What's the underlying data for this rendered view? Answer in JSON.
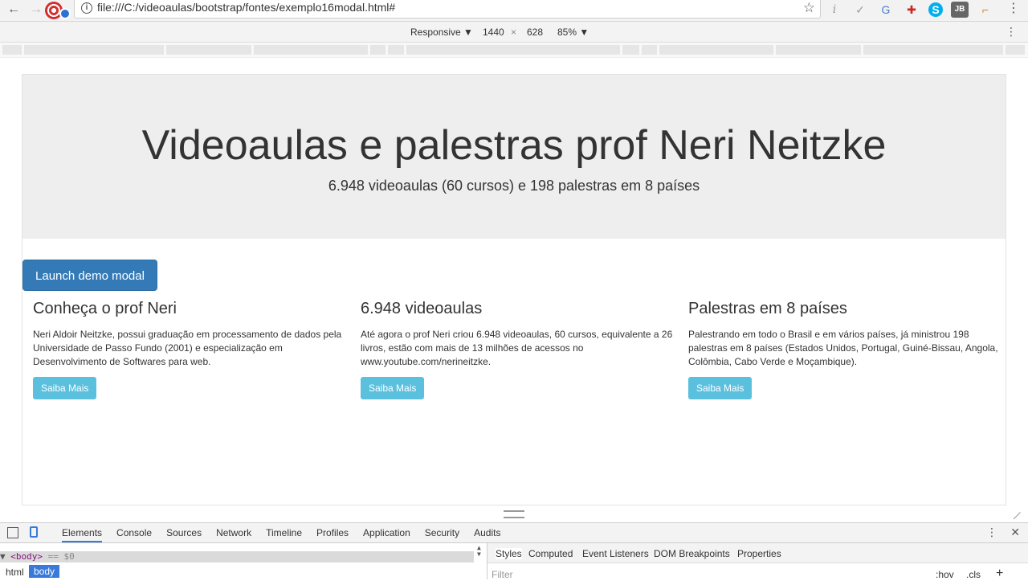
{
  "browser": {
    "url": "file:///C:/videoaulas/bootstrap/fontes/exemplo16modal.html#",
    "back_icon": "back-arrow-icon",
    "forward_icon": "forward-arrow-icon"
  },
  "device_toolbar": {
    "mode": "Responsive ▼",
    "width": "1440",
    "times": "×",
    "height": "628",
    "zoom": "85% ▼"
  },
  "page": {
    "jumbotron": {
      "title": "Videoaulas e palestras prof Neri Neitzke",
      "subtitle": "6.948 videoaulas (60 cursos) e 198 palestras em 8 países"
    },
    "launch_button": "Launch demo modal",
    "columns": [
      {
        "heading": "Conheça o prof Neri",
        "text": "Neri Aldoir Neitzke, possui graduação em processamento de dados pela Universidade de Passo Fundo (2001) e especialização em Desenvolvimento de Softwares para web.",
        "button": "Saiba Mais"
      },
      {
        "heading": "6.948 videoaulas",
        "text": "Até agora o prof Neri criou 6.948 videoaulas, 60 cursos, equivalente a 26 livros, estão com mais de 13 milhões de acessos no www.youtube.com/nerineitzke.",
        "button": "Saiba Mais"
      },
      {
        "heading": "Palestras em 8 países",
        "text": "Palestrando em todo o Brasil e em vários países, já ministrou 198 palestras em 8 países (Estados Unidos, Portugal, Guiné-Bissau, Angola, Colômbia, Cabo Verde e Moçambique).",
        "button": "Saiba Mais"
      }
    ]
  },
  "devtools": {
    "tabs": [
      "Elements",
      "Console",
      "Sources",
      "Network",
      "Timeline",
      "Profiles",
      "Application",
      "Security",
      "Audits"
    ],
    "selected_node": "<body>",
    "selected_suffix": "== $0",
    "breadcrumbs": [
      "html",
      "body"
    ],
    "style_tabs": [
      "Styles",
      "Computed",
      "Event Listeners",
      "DOM Breakpoints",
      "Properties"
    ],
    "filter_placeholder": "Filter",
    "hov": ":hov",
    "cls": ".cls",
    "plus": "+"
  }
}
